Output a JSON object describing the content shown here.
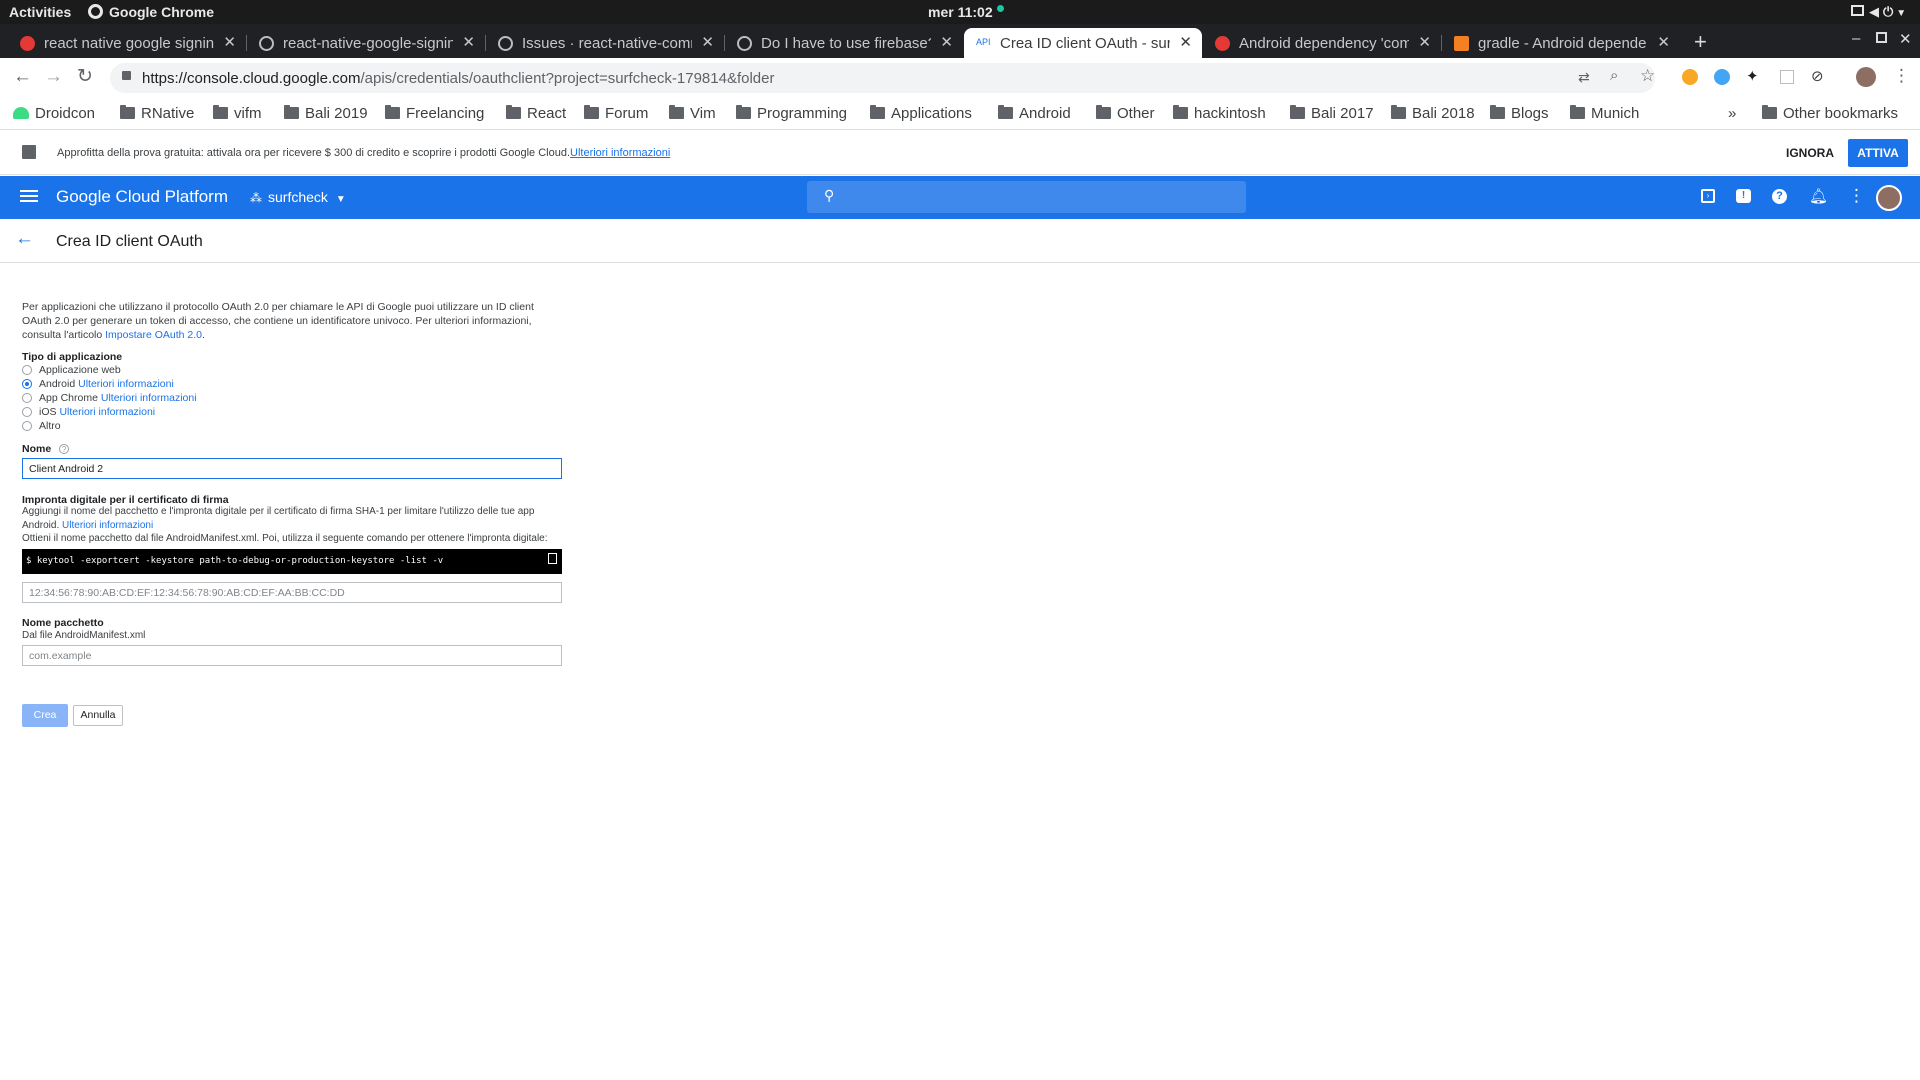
{
  "os_bar": {
    "activities": "Activities",
    "app_name": "Google Chrome",
    "clock": "mer 11:02"
  },
  "tabs": [
    {
      "title": "react native google signin",
      "icon": "red-circle-icon",
      "color": "#e53935"
    },
    {
      "title": "react-native-google-signin",
      "icon": "github-icon",
      "color": "#bdbdbd"
    },
    {
      "title": "Issues · react-native-comm",
      "icon": "github-icon",
      "color": "#bdbdbd"
    },
    {
      "title": "Do I have to use firebase?",
      "icon": "github-icon",
      "color": "#bdbdbd"
    },
    {
      "title": "Crea ID client OAuth - surf",
      "icon": "api-icon",
      "color": "#1a73e8",
      "active": true,
      "fav_text": "API"
    },
    {
      "title": "Android dependency 'com",
      "icon": "red-circle-icon",
      "color": "#e53935"
    },
    {
      "title": "gradle - Android depende",
      "icon": "stackoverflow-icon",
      "color": "#f48024"
    }
  ],
  "address": {
    "host": "https://console.cloud.google.com",
    "path": "/apis/credentials/oauthclient?project=surfcheck-179814&folder"
  },
  "bookmarks": {
    "items": [
      "Droidcon",
      "RNative",
      "vifm",
      "Bali 2019",
      "Freelancing",
      "React",
      "Forum",
      "Vim",
      "Programming",
      "Applications",
      "Android",
      "Other",
      "hackintosh",
      "Bali 2017",
      "Bali 2018",
      "Blogs",
      "Munich"
    ],
    "more": "»",
    "other": "Other bookmarks"
  },
  "banner": {
    "text": "Approfitta della prova gratuita: attivala ora per ricevere $ 300 di credito e scoprire i prodotti Google Cloud.",
    "link": "Ulteriori informazioni",
    "dismiss": "IGNORA",
    "activate": "ATTIVA"
  },
  "gcp": {
    "brand": "Google Cloud Platform",
    "project": "surfcheck"
  },
  "page": {
    "title": "Crea ID client OAuth",
    "intro": "Per applicazioni che utilizzano il protocollo OAuth 2.0 per chiamare le API di Google puoi utilizzare un ID client OAuth 2.0 per generare un token di accesso, che contiene un identificatore univoco. Per ulteriori informazioni, consulta l'articolo",
    "intro_link": "Impostare OAuth 2.0",
    "intro_end": ".",
    "app_type_label": "Tipo di applicazione",
    "app_types": [
      {
        "label": "Applicazione web",
        "link": ""
      },
      {
        "label": "Android",
        "link": "Ulteriori informazioni",
        "selected": true
      },
      {
        "label": "App Chrome",
        "link": "Ulteriori informazioni"
      },
      {
        "label": "iOS",
        "link": "Ulteriori informazioni"
      },
      {
        "label": "Altro",
        "link": ""
      }
    ],
    "name_label": "Nome",
    "name_value": "Client Android 2",
    "fingerprint_label": "Impronta digitale per il certificato di firma",
    "fingerprint_desc": "Aggiungi il nome del pacchetto e l'impronta digitale per il certificato di firma SHA-1 per limitare l'utilizzo delle tue app Android.",
    "fingerprint_link": "Ulteriori informazioni",
    "fingerprint_cmd_desc": "Ottieni il nome pacchetto dal file AndroidManifest.xml. Poi, utilizza il seguente comando per ottenere l'impronta digitale:",
    "command": "$ keytool -exportcert -keystore path-to-debug-or-production-keystore -list -v",
    "sha_placeholder": "12:34:56:78:90:AB:CD:EF:12:34:56:78:90:AB:CD:EF:AA:BB:CC:DD",
    "package_label": "Nome pacchetto",
    "package_desc": "Dal file AndroidManifest.xml",
    "package_placeholder": "com.example",
    "create": "Crea",
    "cancel": "Annulla"
  }
}
